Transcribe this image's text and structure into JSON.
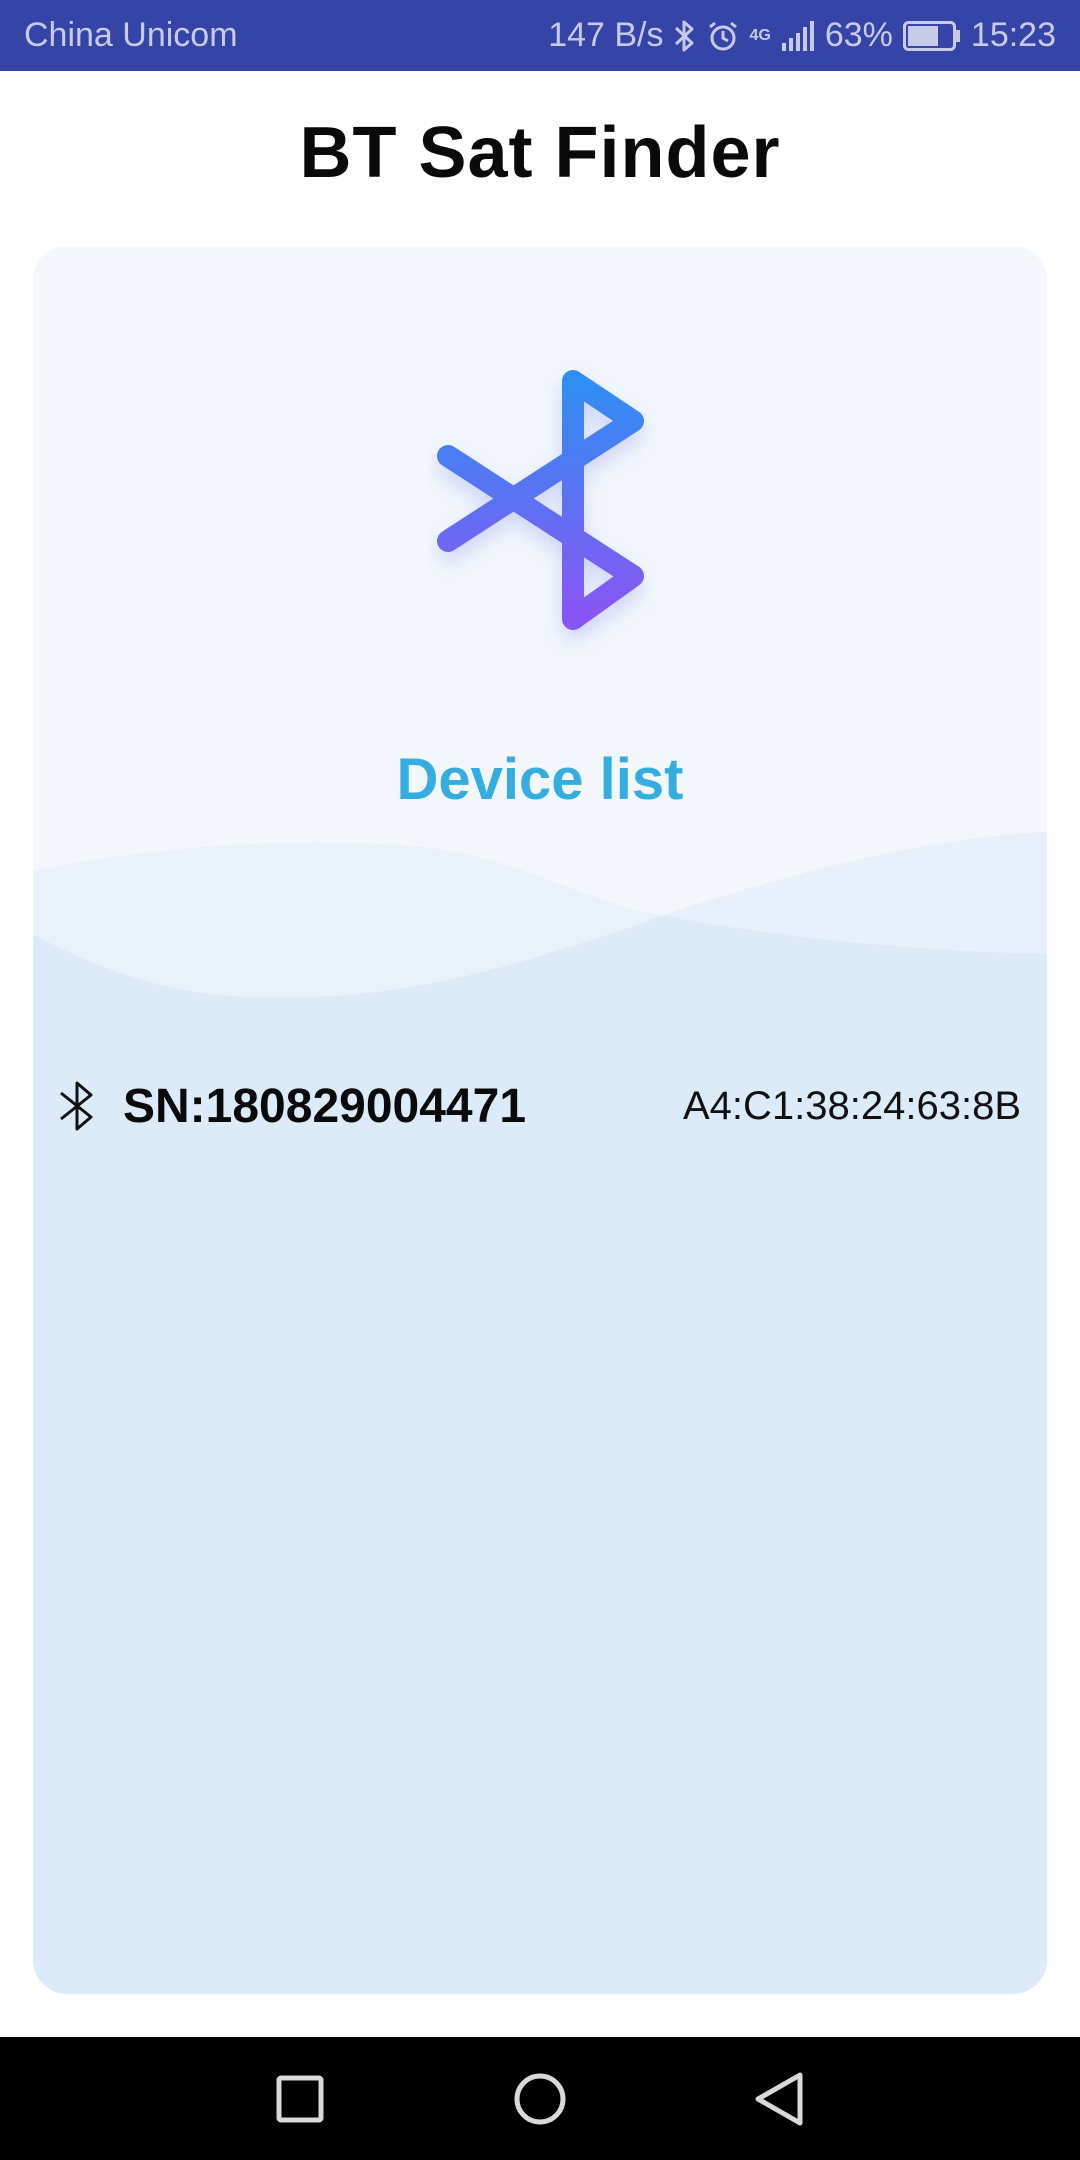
{
  "status_bar": {
    "carrier": "China Unicom",
    "net_speed": "147 B/s",
    "network": "4G",
    "battery_percent": "63%",
    "time": "15:23",
    "icons": [
      "bluetooth-icon",
      "alarm-icon",
      "signal-icon",
      "battery-icon"
    ]
  },
  "header": {
    "title": "BT Sat Finder"
  },
  "card": {
    "logo_icon": "bluetooth-logo-icon",
    "heading": "Device list",
    "devices": [
      {
        "icon": "bluetooth-icon",
        "name": "SN:180829004471",
        "mac": "A4:C1:38:24:63:8B"
      }
    ]
  },
  "nav_bar": {
    "buttons": [
      "recents-button",
      "home-button",
      "back-button"
    ]
  },
  "colors": {
    "status_bar_bg": "#3544a7",
    "heading_accent": "#34aee0",
    "logo_gradient_top": "#2f8ef4",
    "logo_gradient_bottom": "#8a55f5",
    "card_bg": "#dcebf9",
    "card_top_bg": "#f3f7fc"
  }
}
